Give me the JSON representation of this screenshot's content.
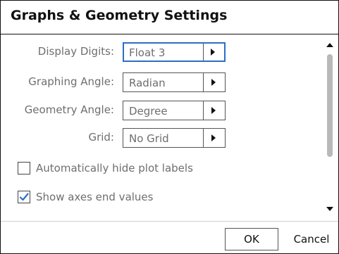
{
  "dialog": {
    "title": "Graphs & Geometry Settings"
  },
  "settings": [
    {
      "label": "Display Digits:",
      "value": "Float 3",
      "focused": true
    },
    {
      "label": "Graphing Angle:",
      "value": "Radian",
      "focused": false
    },
    {
      "label": "Geometry Angle:",
      "value": "Degree",
      "focused": false
    },
    {
      "label": "Grid:",
      "value": "No Grid",
      "focused": false
    }
  ],
  "options": [
    {
      "label": "Automatically hide plot labels",
      "checked": false
    },
    {
      "label": "Show axes end values",
      "checked": true
    }
  ],
  "colors": {
    "focus": "#2a6fc4",
    "label_text": "#6e6e6e",
    "checkmark": "#2a6fc4",
    "scroll_thumb": "#b9b9b9"
  },
  "buttons": {
    "ok": "OK",
    "cancel": "Cancel"
  }
}
